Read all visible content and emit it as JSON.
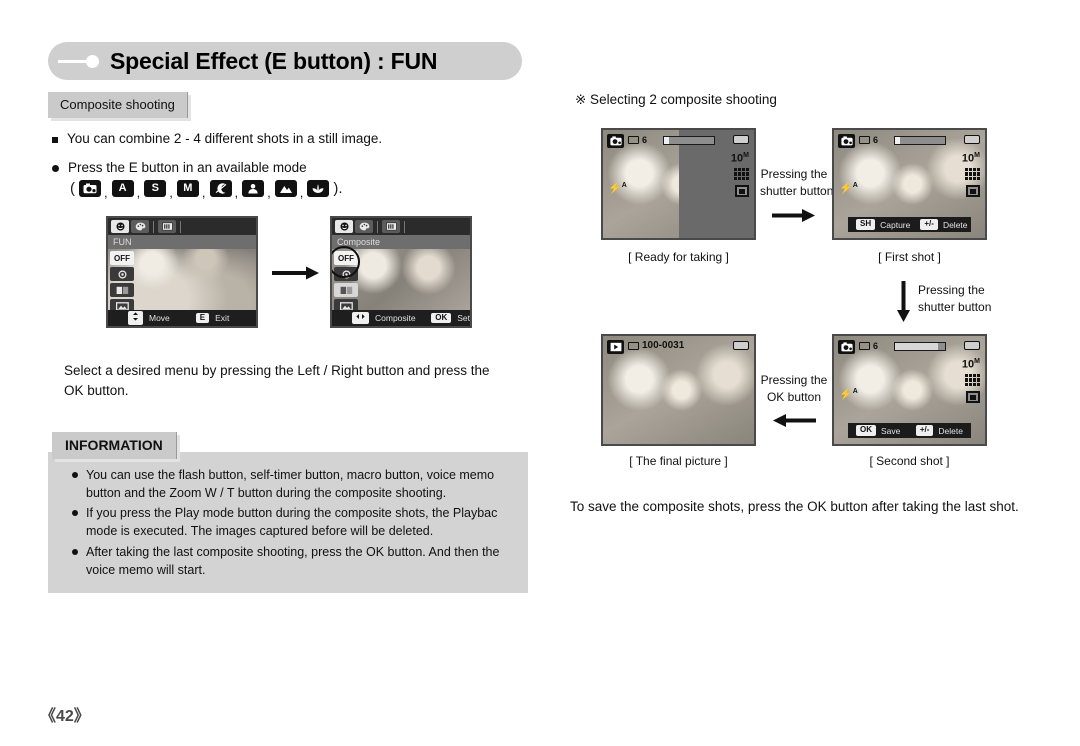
{
  "header": {
    "title": "Special Effect (E button) : FUN",
    "subtab": "Composite shooting"
  },
  "left_column": {
    "bullet_1": "You can combine 2 - 4 different shots in a still image.",
    "bullet_2": "Press the E button in an available mode",
    "mode_open_paren": "(",
    "mode_close_paren": ").",
    "mode_separator": ",",
    "mode_icons": [
      {
        "name": "auto-camera-mode-icon",
        "label": ""
      },
      {
        "name": "aperture-priority-mode-icon",
        "label": "A"
      },
      {
        "name": "shutter-priority-mode-icon",
        "label": "S"
      },
      {
        "name": "manual-mode-icon",
        "label": "M"
      },
      {
        "name": "night-scene-mode-icon",
        "label": ""
      },
      {
        "name": "portrait-mode-icon",
        "label": ""
      },
      {
        "name": "landscape-mode-icon",
        "label": ""
      },
      {
        "name": "macro-mode-icon",
        "label": ""
      }
    ],
    "mid_text": "Select a desired menu by pressing the Left / Right button and press the OK button."
  },
  "lcd_menu_left": {
    "title": "FUN",
    "items": [
      {
        "label": "OFF",
        "state": "selected"
      },
      {
        "label": "",
        "state": "normal"
      },
      {
        "label": "",
        "state": "normal"
      },
      {
        "label": "",
        "state": "normal"
      }
    ],
    "footer": {
      "key1": "",
      "label1": "Move",
      "key2": "E",
      "label2": "Exit"
    }
  },
  "lcd_menu_right": {
    "title": "Composite",
    "items": [
      {
        "label": "OFF",
        "state": "normal"
      },
      {
        "label": "",
        "state": "normal"
      },
      {
        "label": "",
        "state": "selected"
      },
      {
        "label": "",
        "state": "normal"
      }
    ],
    "footer": {
      "key1": "",
      "label1": "Composite",
      "key2": "OK",
      "label2": "Set"
    }
  },
  "information": {
    "title": "INFORMATION",
    "items": [
      "You can use the flash button, self-timer button, macro button, voice memo button and the Zoom W / T button during the composite shooting.",
      "If you press the Play mode button during the composite shots, the Playbac mode is executed. The images captured before will be deleted.",
      "After taking the last composite shooting, press the OK button. And then the voice memo will start."
    ]
  },
  "right_column": {
    "heading": "※ Selecting 2 composite shooting",
    "bottom_note": "To save the composite shots, press the OK button after taking the last shot.",
    "screens": {
      "ready": {
        "caption": "[ Ready for taking ]",
        "mode_icon": "record-mode-icon",
        "shots_remaining": "6",
        "resolution": "10",
        "flash_mode": "A"
      },
      "first_shot": {
        "caption": "[ First shot ]",
        "mode_icon": "record-mode-icon",
        "shots_remaining": "6",
        "resolution": "10",
        "flash_mode": "A",
        "footer": {
          "key1": "SH",
          "label1": "Capture",
          "key2": "+/-",
          "label2": "Delete"
        }
      },
      "second_shot": {
        "caption": "[ Second shot ]",
        "mode_icon": "record-mode-icon",
        "shots_remaining": "6",
        "resolution": "10",
        "flash_mode": "A",
        "footer": {
          "key1": "OK",
          "label1": "Save",
          "key2": "+/-",
          "label2": "Delete"
        }
      },
      "final_picture": {
        "caption": "[ The final picture ]",
        "mode_icon": "play-mode-icon",
        "file_number": "100-0031"
      }
    },
    "steps": {
      "step1": "Pressing the\nshutter button",
      "step1_line1": "Pressing the",
      "step1_line2": "shutter button",
      "step2_line1": "Pressing the",
      "step2_line2": "shutter button",
      "step3_line1": "Pressing the",
      "step3_line2": "OK button"
    }
  },
  "footer": {
    "page_number": "《42》"
  }
}
